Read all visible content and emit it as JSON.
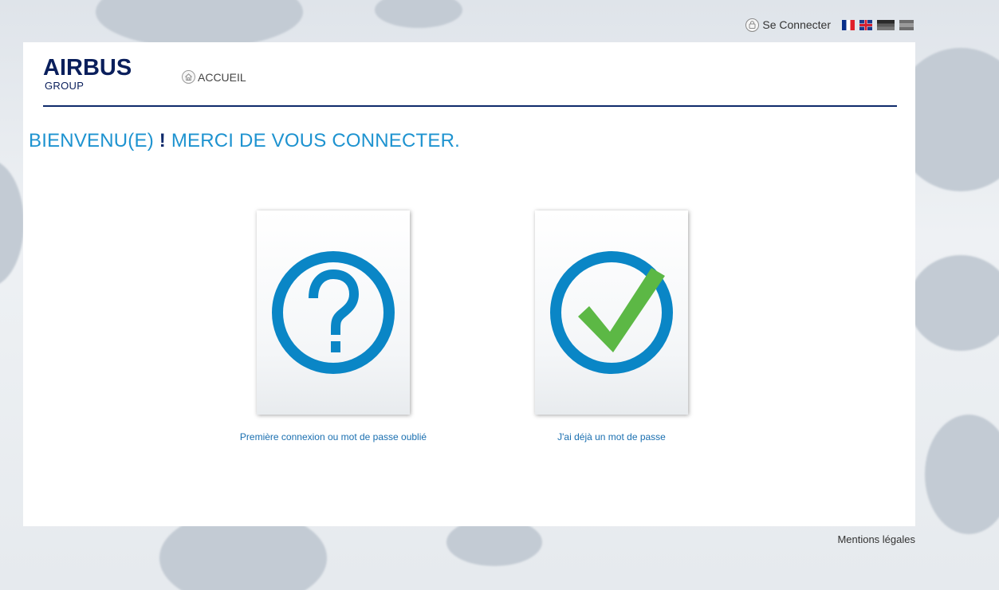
{
  "topbar": {
    "connect_label": "Se Connecter",
    "lock_icon": "lock-icon",
    "flags": [
      "flag-fr",
      "flag-uk",
      "flag-de",
      "flag-es"
    ]
  },
  "header": {
    "logo_main": "AIRBUS",
    "logo_sub": "GROUP",
    "home_label": "ACCUEIL",
    "home_icon": "home-icon"
  },
  "main": {
    "welcome_part1": "BIENVENU(E) ",
    "welcome_excl": "!",
    "welcome_part2": " MERCI DE VOUS CONNECTER.",
    "cards": [
      {
        "icon": "question-circle-icon",
        "label": "Première connexion ou mot de passe oublié"
      },
      {
        "icon": "check-circle-icon",
        "label": "J'ai déjà un mot de passe"
      }
    ]
  },
  "footer": {
    "legal_label": "Mentions légales"
  },
  "colors": {
    "brand_navy": "#0a1f5c",
    "title_blue": "#1e93d0",
    "icon_blue": "#0a86c6",
    "check_green": "#5cb845"
  }
}
